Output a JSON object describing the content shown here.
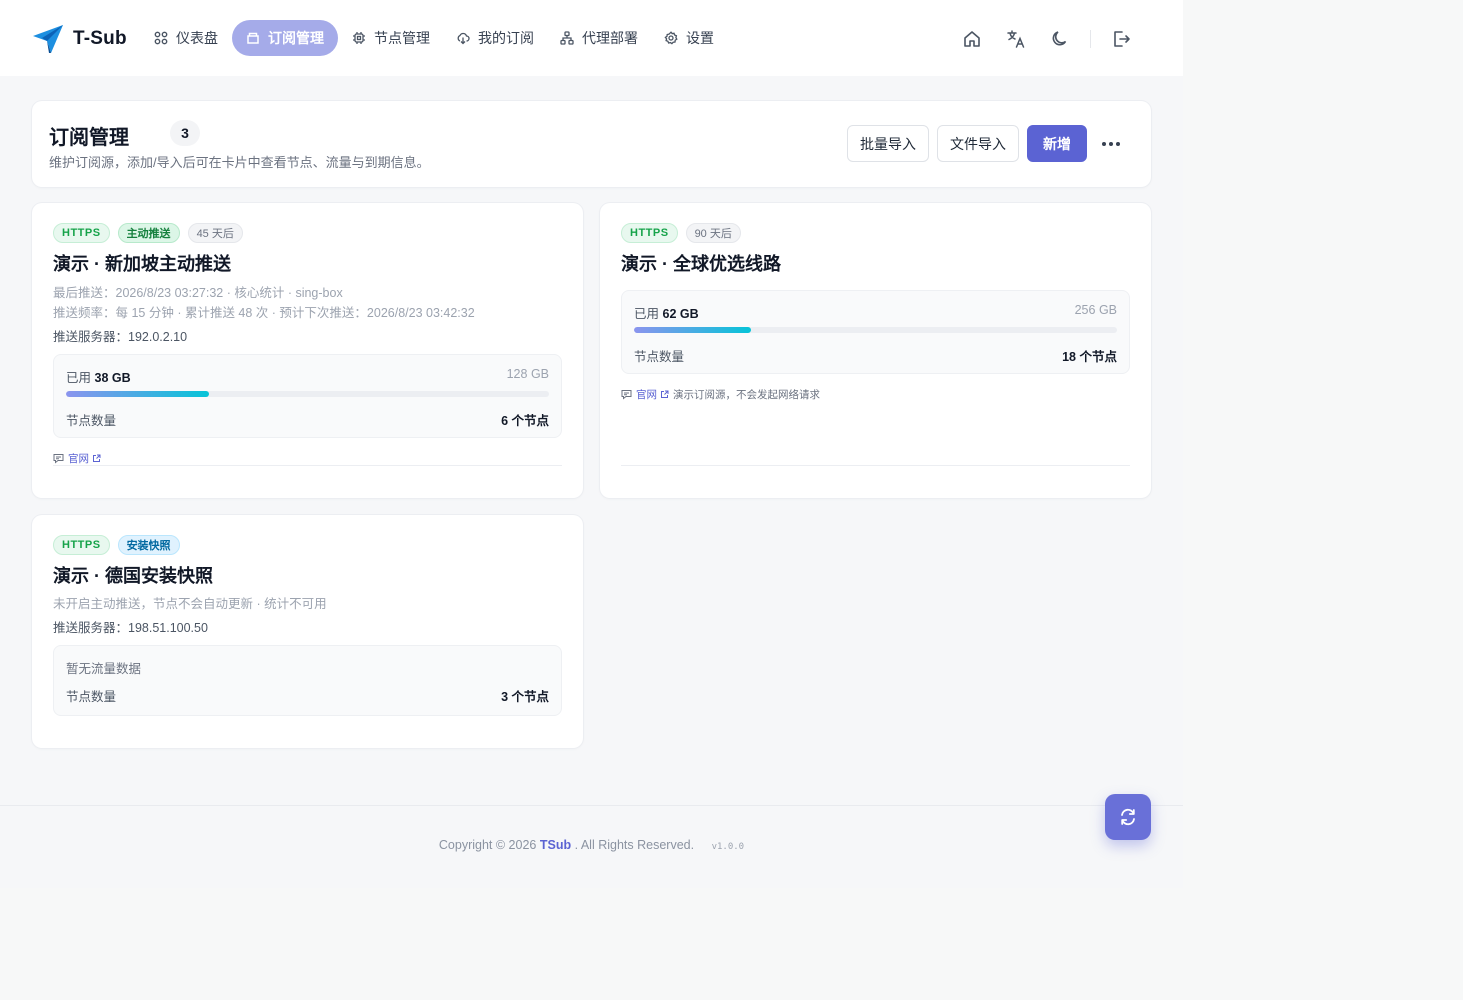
{
  "brand": {
    "name": "T-Sub",
    "logo_icon": "paper-plane-logo",
    "accent": "#5b63d3"
  },
  "nav": {
    "items": [
      {
        "label": "仪表盘",
        "icon": "grid-icon"
      },
      {
        "label": "订阅管理",
        "icon": "folder-icon",
        "active": true
      },
      {
        "label": "节点管理",
        "icon": "chip-icon"
      },
      {
        "label": "我的订阅",
        "icon": "cloud-download-icon"
      },
      {
        "label": "代理部署",
        "icon": "network-icon"
      },
      {
        "label": "设置",
        "icon": "gear-icon"
      }
    ],
    "right_icons": [
      "home-icon",
      "translate-icon",
      "moon-icon",
      "logout-icon"
    ]
  },
  "header": {
    "title": "订阅管理",
    "count": "3",
    "description": "维护订阅源，添加/导入后可在卡片中查看节点、流量与到期信息。",
    "buttons": {
      "batch_import": "批量导入",
      "file_import": "文件导入",
      "add": "新增"
    }
  },
  "subscriptions": [
    {
      "tags": [
        "HTTPS",
        "主动推送",
        "45 天后"
      ],
      "title": "演示 · 新加坡主动推送",
      "meta_line1": "最后推送：2026/8/23 03:27:32 · 核心统计 · sing-box",
      "meta_line2": "推送频率：每 15 分钟 · 累计推送 48 次 · 预计下次推送：2026/8/23 03:42:32",
      "server": "推送服务器：192.0.2.10",
      "usage": {
        "used_label": "已用",
        "used": "38 GB",
        "total": "128 GB",
        "fraction": 0.297
      },
      "nodes_label": "节点数量",
      "nodes": "6 个节点",
      "link_label": "官网"
    },
    {
      "tags": [
        "HTTPS",
        "90 天后"
      ],
      "title": "演示 · 全球优选线路",
      "usage": {
        "used_label": "已用",
        "used": "62 GB",
        "total": "256 GB",
        "fraction": 0.242
      },
      "nodes_label": "节点数量",
      "nodes": "18 个节点",
      "link_label": "官网",
      "link_note": "演示订阅源，不会发起网络请求"
    },
    {
      "tags": [
        "HTTPS",
        "安装快照"
      ],
      "title": "演示 · 德国安装快照",
      "meta_line1": "未开启主动推送，节点不会自动更新 · 统计不可用",
      "server": "推送服务器：198.51.100.50",
      "usage_empty": "暂无流量数据",
      "nodes_label": "节点数量",
      "nodes": "3 个节点"
    }
  ],
  "footer": {
    "prefix": "Copyright © 2026",
    "brand": "TSub",
    "suffix": ". All Rights Reserved.",
    "version": "v1.0.0"
  },
  "fab": {
    "icon": "refresh-icon"
  }
}
